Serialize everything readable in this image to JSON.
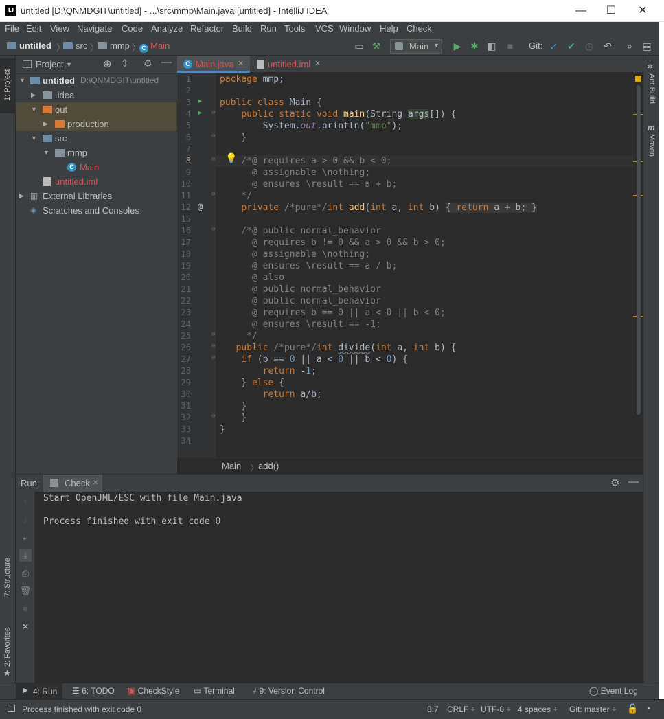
{
  "title_bar": {
    "title": "untitled [D:\\QNMDGIT\\untitled] - ...\\src\\mmp\\Main.java [untitled] - IntelliJ IDEA",
    "minimize": "—",
    "maximize": "☐",
    "close": "✕"
  },
  "menu": [
    "File",
    "Edit",
    "View",
    "Navigate",
    "Code",
    "Analyze",
    "Refactor",
    "Build",
    "Run",
    "Tools",
    "VCS",
    "Window",
    "Help",
    "Check"
  ],
  "nav": {
    "crumbs": [
      "untitled",
      "src",
      "mmp",
      "Main"
    ],
    "run_config": "Main",
    "git_label": "Git:"
  },
  "left_stripe": {
    "project_tab": "1: Project",
    "structure_tab": "7: Structure",
    "favorites_tab": "2: Favorites"
  },
  "right_stripe": {
    "ant_tab": "Ant Build",
    "maven_tab": "Maven"
  },
  "project": {
    "header": "Project",
    "tree": [
      {
        "label": "untitled",
        "extra": "D:\\QNMDGIT\\untitled"
      },
      {
        "label": ".idea"
      },
      {
        "label": "out"
      },
      {
        "label": "production"
      },
      {
        "label": "src"
      },
      {
        "label": "mmp"
      },
      {
        "label": "Main"
      },
      {
        "label": "untitled.iml"
      },
      {
        "label": "External Libraries"
      },
      {
        "label": "Scratches and Consoles"
      }
    ]
  },
  "editor": {
    "tabs": [
      "Main.java",
      "untitled.iml"
    ],
    "line_numbers": [
      "1",
      "2",
      "3",
      "4",
      "5",
      "6",
      "7",
      "8",
      "9",
      "10",
      "11",
      "12",
      "15",
      "16",
      "17",
      "18",
      "19",
      "20",
      "21",
      "22",
      "23",
      "24",
      "25",
      "26",
      "27",
      "28",
      "29",
      "30",
      "31",
      "32",
      "33",
      "34"
    ],
    "breadcrumb": [
      "Main",
      "add()"
    ]
  },
  "run": {
    "label": "Run:",
    "tab": "Check",
    "output": [
      "Start OpenJML/ESC with file Main.java",
      "",
      "Process finished with exit code 0"
    ]
  },
  "bottom_tabs": [
    "4: Run",
    "6: TODO",
    "CheckStyle",
    "Terminal",
    "9: Version Control",
    "Event Log"
  ],
  "status": {
    "message": "Process finished with exit code 0",
    "position": "8:7",
    "line_sep": "CRLF ÷",
    "encoding": "UTF-8 ÷",
    "indent": "4 spaces ÷",
    "git": "Git: master ÷"
  },
  "colors": {
    "keyword": "#cc7832",
    "comment": "#808080",
    "number": "#6897bb",
    "string": "#6a8759",
    "function": "#ffc66d",
    "background": "#2b2b2b"
  }
}
